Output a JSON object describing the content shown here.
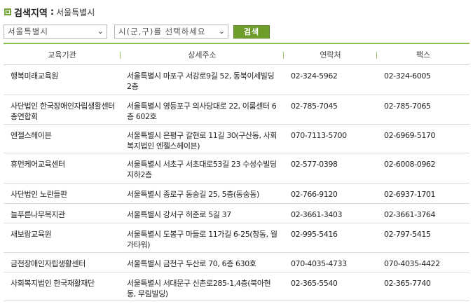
{
  "header": {
    "title": "검색지역",
    "colon": ":",
    "region": "서울특별시"
  },
  "filters": {
    "city": "서울특별시",
    "district_placeholder": "시(군,구)를 선택하세요",
    "search_label": "검색"
  },
  "table": {
    "columns": [
      "교육기관",
      "상세주소",
      "연락처",
      "팩스"
    ],
    "rows": [
      {
        "name": "행복미래교육원",
        "address": "서울특별시 마포구 서강로9길 52, 동북이세빌딩 2층",
        "phone": "02-324-5962",
        "fax": "02-324-6005"
      },
      {
        "name": "사단법인 한국장애인자립생활센터총연합회",
        "address": "서울특별시 영등포구 의사당대로 22, 이룸센터 6층 602호",
        "phone": "02-785-7045",
        "fax": "02-785-7065"
      },
      {
        "name": "엔젤스헤이븐",
        "address": "서울특별시 은평구 갈현로 11길 30(구산동, 사회복지법인 엔젤스헤이븐)",
        "phone": "070-7113-5700",
        "fax": "02-6969-5170"
      },
      {
        "name": "휴먼케어교육센터",
        "address": "서울특별시 서초구 서초대로53길 23 수성수빌딩 지하2층",
        "phone": "02-577-0398",
        "fax": "02-6008-0962"
      },
      {
        "name": "사단법인 노란들판",
        "address": "서울특별시 종로구 동숭길 25, 5층(동숭동)",
        "phone": "02-766-9120",
        "fax": "02-6937-1701"
      },
      {
        "name": "늘푸른나무복지관",
        "address": "서울특별시 강서구 허준로 5길 37",
        "phone": "02-3661-3403",
        "fax": "02-3661-3764"
      },
      {
        "name": "새보람교육원",
        "address": "서울특별시 도봉구 마들로 11가길 6-25(창동, 월가타워)",
        "phone": "02-995-5416",
        "fax": "02-797-5415"
      },
      {
        "name": "금천장애인자립생활센터",
        "address": "서울특별시 금천구 두산로 70, 6층 630호",
        "phone": "070-4035-4733",
        "fax": "070-4035-4422"
      },
      {
        "name": "사회복지법인 한국재활재단",
        "address": "서울특별시 서대문구 신촌로285-1,4층(북아현동, 무림빌딩)",
        "phone": "02-365-5540",
        "fax": "02-365-7740"
      }
    ]
  }
}
